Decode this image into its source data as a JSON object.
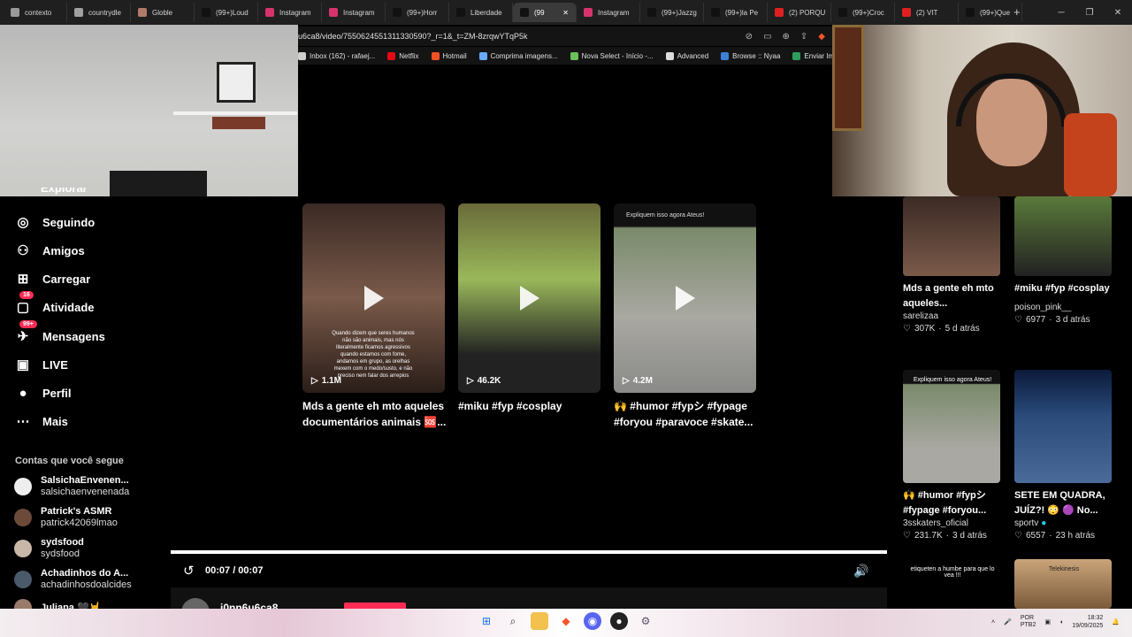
{
  "browser": {
    "tabs": [
      {
        "label": "contexto",
        "color": "#9a9a9a"
      },
      {
        "label": "countrydle",
        "color": "#a0a0a0"
      },
      {
        "label": "Globle",
        "color": "#b07a6a"
      },
      {
        "label": "(99+)Loud",
        "color": "#111111"
      },
      {
        "label": "Instagram",
        "color": "#d6336c"
      },
      {
        "label": "Instagram",
        "color": "#d6336c"
      },
      {
        "label": "(99+)Horr",
        "color": "#111111"
      },
      {
        "label": "Liberdade",
        "color": "#111111"
      },
      {
        "label": "(99",
        "color": "#111111",
        "active": true
      },
      {
        "label": "Instagram",
        "color": "#d6336c"
      },
      {
        "label": "(99+)Jazzg",
        "color": "#111111"
      },
      {
        "label": "(99+)la Pe",
        "color": "#111111"
      },
      {
        "label": "(2) PORQU",
        "color": "#e02020"
      },
      {
        "label": "(99+)Croc",
        "color": "#111111"
      },
      {
        "label": "(2) VIT",
        "color": "#e02020"
      },
      {
        "label": "(99+)Que",
        "color": "#111111"
      }
    ],
    "new_tab": "+",
    "window_controls": {
      "minimize": "─",
      "restore": "❐",
      "close": "✕"
    },
    "url": "u6ca8/video/7550624551311330590?_r=1&_t=ZM-8zrqwYTqP5k",
    "bookmarks": [
      {
        "label": "Inbox (162) - rafaej...",
        "color": "#cfcfcf"
      },
      {
        "label": "Netflix",
        "color": "#e50914"
      },
      {
        "label": "Hotmail",
        "color": "#f25022"
      },
      {
        "label": "Comprima imagens...",
        "color": "#6aa9ff"
      },
      {
        "label": "Nova Select - Início -...",
        "color": "#6bbf59"
      },
      {
        "label": "Advanced",
        "color": "#dddddd"
      },
      {
        "label": "Browse :: Nyaa",
        "color": "#3d7fd6"
      },
      {
        "label": "Enviar Imagem p",
        "color": "#2f9c5a"
      }
    ]
  },
  "sidebar": {
    "partial_label": "Explorar",
    "items": [
      {
        "label": "Seguindo",
        "icon": "avatar-ring-icon"
      },
      {
        "label": "Amigos",
        "icon": "friends-icon"
      },
      {
        "label": "Carregar",
        "icon": "upload-icon"
      },
      {
        "label": "Atividade",
        "icon": "activity-icon",
        "badge": "16"
      },
      {
        "label": "Mensagens",
        "icon": "messages-icon",
        "badge": "99+"
      },
      {
        "label": "LIVE",
        "icon": "live-icon"
      },
      {
        "label": "Perfil",
        "icon": "profile-icon"
      },
      {
        "label": "Mais",
        "icon": "more-icon"
      }
    ],
    "following_title": "Contas que você segue",
    "accounts": [
      {
        "name": "SalsichaEnvenen...",
        "handle": "salsichaenvenenada"
      },
      {
        "name": "Patrick's ASMR",
        "handle": "patrick42069lmao"
      },
      {
        "name": "sydsfood",
        "handle": "sydsfood"
      },
      {
        "name": "Achadinhos do A...",
        "handle": "achadinhosdoalcides"
      },
      {
        "name": "Juliana 🖤🤘",
        "handle": ""
      }
    ]
  },
  "cards": [
    {
      "views": "1.1M",
      "caption": "Mds a gente eh mto aqueles documentários animais 🆘...",
      "overlay": "Quando dizem que seres humanos não são animais, mas nós literalmente ficamos agressivos quando estamos com fome, andamos em grupo, as orelhas mexem com o medo/susto, e não preciso nem falar dos arrepios"
    },
    {
      "views": "46.2K",
      "caption": "#miku #fyp #cosplay",
      "overlay": ""
    },
    {
      "views": "4.2M",
      "caption": "🙌 #humor #fypシ #fypage #foryou #paravoce #skate...",
      "overlay": "Expliquem isso agora Ateus!"
    }
  ],
  "right_column": [
    {
      "title": "Mds a gente eh mto aqueles...",
      "user": "sarelizaa",
      "likes": "307K",
      "age": "5 d atrás",
      "verified": false
    },
    {
      "title": "#miku #fyp #cosplay",
      "user": "poison_pink__",
      "likes": "6977",
      "age": "3 d atrás",
      "verified": false
    },
    {
      "title": "🙌 #humor #fypシ #fypage #foryou...",
      "user": "3sskaters_oficial",
      "likes": "231.7K",
      "age": "3 d atrás",
      "verified": false,
      "overlay": "Expliquem isso agora Ateus!"
    },
    {
      "title": "SETE EM QUADRA, JUÍZ?! 😳 🟣 No...",
      "user": "sportv",
      "likes": "6557",
      "age": "23 h atrás",
      "verified": true
    },
    {
      "title": "",
      "user": "",
      "likes": "",
      "age": "",
      "overlay": "etiqueten a humbe para que lo vea !!!"
    },
    {
      "title": "",
      "user": "",
      "likes": "",
      "age": "",
      "overlay": "Telekinesis"
    }
  ],
  "player": {
    "time": "00:07 / 00:07",
    "progress": 1.0,
    "author_partial": "j0nn6u6ca8"
  },
  "taskbar": {
    "lang_top": "POR",
    "lang_bottom": "PTB2",
    "time": "18:32",
    "date": "19/09/2025"
  }
}
